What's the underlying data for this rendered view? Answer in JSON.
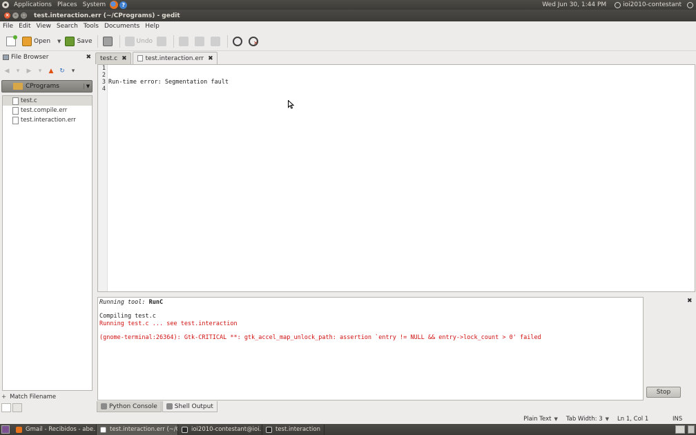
{
  "top_panel": {
    "menus": [
      "Applications",
      "Places",
      "System"
    ],
    "clock": "Wed Jun 30,  1:44 PM",
    "user": "ioi2010-contestant"
  },
  "window": {
    "title": "test.interaction.err (~/CPrograms) - gedit"
  },
  "menubar": [
    "File",
    "Edit",
    "View",
    "Search",
    "Tools",
    "Documents",
    "Help"
  ],
  "toolbar": {
    "open": "Open",
    "save": "Save",
    "undo": "Undo"
  },
  "side_pane": {
    "title": "File Browser",
    "folder": "CPrograms",
    "files": [
      "test.c",
      "test.compile.err",
      "test.interaction.err"
    ],
    "match_filename": "Match Filename"
  },
  "editor": {
    "tabs": [
      "test.c",
      "test.interaction.err"
    ],
    "line_numbers": [
      "1",
      "2",
      "3",
      "4"
    ],
    "lines": [
      "",
      "",
      "Run-time error: Segmentation fault",
      ""
    ]
  },
  "output": {
    "running_label": "Running tool: ",
    "running_tool": "RunC",
    "lines": [
      "Compiling test.c",
      "Running test.c ... see test.interaction",
      "(gnome-terminal:26364): Gtk-CRITICAL **: gtk_accel_map_unlock_path: assertion `entry != NULL && entry->lock_count > 0' failed"
    ],
    "stop": "Stop",
    "tabs": [
      "Python Console",
      "Shell Output"
    ]
  },
  "statusbar": {
    "language": "Plain Text",
    "tab_width": "Tab Width:  3",
    "position": "Ln 1, Col 1",
    "mode": "INS"
  },
  "taskbar": [
    "Gmail - Recibidos - abe...",
    "test.interaction.err (~/C...",
    "ioi2010-contestant@ioi...",
    "test.interaction"
  ]
}
